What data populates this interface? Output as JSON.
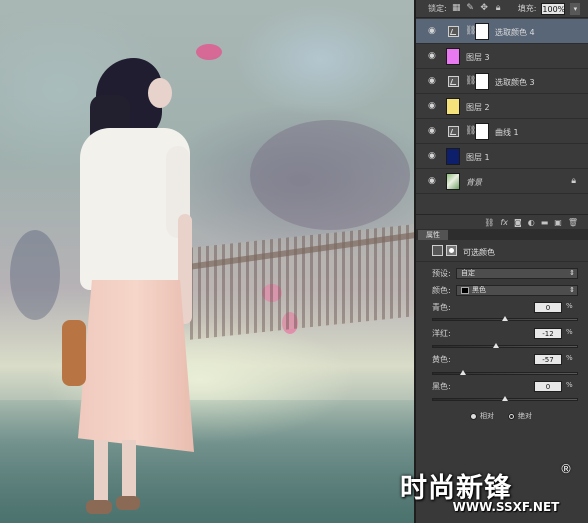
{
  "layers_panel": {
    "lock_label": "锁定:",
    "fill_label": "填充:",
    "fill_value": "100%",
    "layers": [
      {
        "name": "选取颜色 4",
        "kind": "adjustment",
        "selected": true
      },
      {
        "name": "图层 3",
        "kind": "fill",
        "color": "#e879f0"
      },
      {
        "name": "选取颜色 3",
        "kind": "adjustment"
      },
      {
        "name": "图层 2",
        "kind": "fill",
        "color": "#f5e27a"
      },
      {
        "name": "曲线 1",
        "kind": "adjustment"
      },
      {
        "name": "图层 1",
        "kind": "fill",
        "color": "#0d1f6b"
      },
      {
        "name": "背景",
        "kind": "background",
        "locked": true
      }
    ]
  },
  "properties_panel": {
    "tab_label": "属性",
    "title": "可选颜色",
    "preset_label": "预设:",
    "preset_value": "自定",
    "colors_label": "颜色:",
    "colors_value": "黑色",
    "sliders": [
      {
        "label": "青色:",
        "value": "0",
        "unit": "%",
        "fraction": 0.5
      },
      {
        "label": "洋红:",
        "value": "-12",
        "unit": "%",
        "fraction": 0.44
      },
      {
        "label": "黄色:",
        "value": "-57",
        "unit": "%",
        "fraction": 0.215
      },
      {
        "label": "黑色:",
        "value": "0",
        "unit": "%",
        "fraction": 0.5
      }
    ],
    "method_relative": "相对",
    "method_absolute": "绝对",
    "method_selected": "绝对"
  },
  "watermark": {
    "brand": "时尚新锋",
    "registered": "®",
    "url": "WWW.SSXF.NET"
  },
  "colors": {
    "panel_bg": "#3a3a3a",
    "selection": "#596678"
  }
}
